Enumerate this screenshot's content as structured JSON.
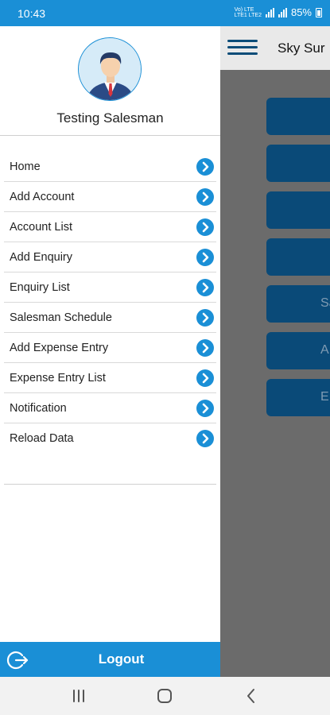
{
  "status_bar": {
    "time": "10:43",
    "network_line1": "Vo) LTE",
    "network_line2": "LTE1 LTE2",
    "battery_percent": "85%",
    "background_color": "#1a8fd6"
  },
  "background_app": {
    "title": "Sky Sur",
    "tiles": [
      "",
      "",
      "",
      "",
      "Sa",
      "A",
      "E"
    ]
  },
  "drawer": {
    "user_name": "Testing Salesman",
    "avatar_icon": "salesman-avatar-icon",
    "menu_items": [
      {
        "label": "Home"
      },
      {
        "label": "Add Account"
      },
      {
        "label": "Account List"
      },
      {
        "label": "Add Enquiry"
      },
      {
        "label": "Enquiry List"
      },
      {
        "label": "Salesman Schedule"
      },
      {
        "label": "Add Expense Entry"
      },
      {
        "label": "Expense Entry List"
      },
      {
        "label": "Notification"
      },
      {
        "label": "Reload Data"
      }
    ],
    "logout_label": "Logout",
    "accent_color": "#1a8fd6"
  },
  "nav_bar": {
    "icons": [
      "recent-apps-icon",
      "home-icon",
      "back-icon"
    ]
  }
}
